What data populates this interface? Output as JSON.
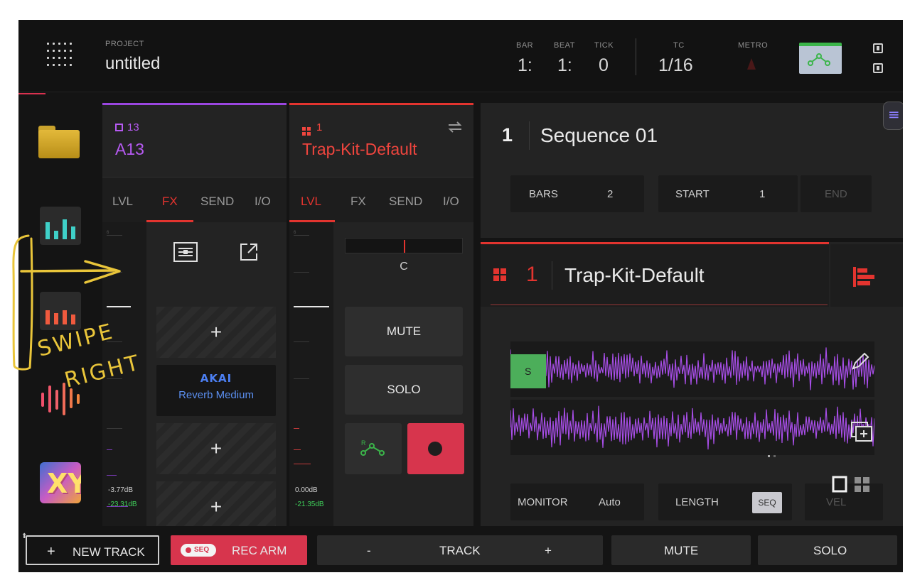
{
  "header": {
    "project_label": "PROJECT",
    "project_name": "untitled",
    "bar_label": "BAR",
    "beat_label": "BEAT",
    "tick_label": "TICK",
    "tc_label": "TC",
    "metro_label": "METRO",
    "bar_value": "1:",
    "beat_value": "1:",
    "tick_value": "0",
    "tc_value": "1/16"
  },
  "left_nav": {
    "items": [
      "folder-icon",
      "mixer-icon",
      "channel-mixer-icon",
      "sample-edit-icon",
      "xy-fx-icon"
    ]
  },
  "fx_panel": {
    "id": "13",
    "name": "A13",
    "tabs": [
      "LVL",
      "FX",
      "SEND",
      "I/O"
    ],
    "active_tab": "FX",
    "level_db": "-3.77dB",
    "peak_db": "-23.31dB",
    "slot_add": "+",
    "plugin_brand": "AKAI",
    "plugin_name": "Reverb Medium"
  },
  "track_panel": {
    "id": "1",
    "name": "Trap-Kit-Default",
    "tabs": [
      "LVL",
      "FX",
      "SEND",
      "I/O"
    ],
    "active_tab": "LVL",
    "pan_value": "C",
    "mute_label": "MUTE",
    "solo_label": "SOLO",
    "level_db": "0.00dB",
    "peak_db": "-21.35dB"
  },
  "sequence": {
    "number": "1",
    "name": "Sequence 01",
    "bars_label": "BARS",
    "bars_value": "2",
    "start_label": "START",
    "start_value": "1",
    "end_label": "END"
  },
  "track_editor": {
    "number": "1",
    "name": "Trap-Kit-Default",
    "start_marker": "S",
    "monitor_label": "MONITOR",
    "monitor_value": "Auto",
    "length_label": "LENGTH",
    "length_value": "SEQ",
    "velocity_label": "VEL"
  },
  "bottom_bar": {
    "new_track_plus": "+",
    "new_track_label": "NEW TRACK",
    "seq_pill": "SEQ",
    "rec_arm_label": "REC ARM",
    "track_minus": "-",
    "track_label": "TRACK",
    "track_plus": "+",
    "mute_label": "MUTE",
    "solo_label": "SOLO"
  },
  "annotation": {
    "line1": "SWIPE",
    "line2": "RIGHT"
  },
  "colors": {
    "accent_red": "#e3342f",
    "accent_purple": "#9b46e0",
    "rec_red": "#d7354d",
    "waveform": "#a84ee8",
    "annotation_yellow": "#e9c53a"
  }
}
